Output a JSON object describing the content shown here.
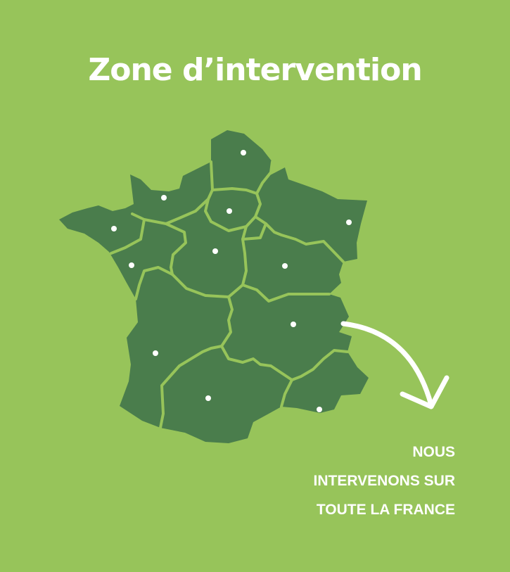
{
  "title": "Zone d’intervention",
  "callout": {
    "lines": [
      "NOUS",
      "INTERVENONS SUR",
      "TOUTE LA FRANCE"
    ]
  },
  "colors": {
    "background": "#97c45a",
    "land": "#4a7d4c",
    "borders": "#97c45a",
    "markers": "#ffffff",
    "arrow": "#ffffff"
  },
  "map": {
    "country": "France",
    "region_markers": [
      "hauts-de-france",
      "normandie",
      "ile-de-france",
      "grand-est",
      "bretagne",
      "pays-de-la-loire",
      "centre-val-de-loire",
      "bourgogne-franche-comte",
      "auvergne-rhone-alpes",
      "nouvelle-aquitaine",
      "occitanie",
      "provence-alpes-cote-d-azur"
    ]
  }
}
